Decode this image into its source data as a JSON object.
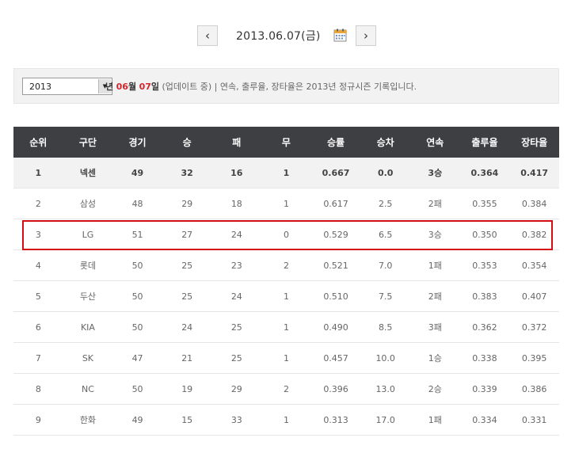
{
  "date_nav": {
    "prev_label": "‹",
    "next_label": "›",
    "date": "2013.06.07(금)"
  },
  "filter": {
    "year_selected": "2013",
    "year_unit": "년",
    "month": "06",
    "month_unit": "월",
    "day": "07",
    "day_unit": "일",
    "note": "(업데이트 중) | 연속, 출루율, 장타율은 2013년 정규시즌 기록입니다."
  },
  "table": {
    "headers": [
      "순위",
      "구단",
      "경기",
      "승",
      "패",
      "무",
      "승률",
      "승차",
      "연속",
      "출루율",
      "장타율"
    ],
    "rows": [
      [
        "1",
        "넥센",
        "49",
        "32",
        "16",
        "1",
        "0.667",
        "0.0",
        "3승",
        "0.364",
        "0.417"
      ],
      [
        "2",
        "삼성",
        "48",
        "29",
        "18",
        "1",
        "0.617",
        "2.5",
        "2패",
        "0.355",
        "0.384"
      ],
      [
        "3",
        "LG",
        "51",
        "27",
        "24",
        "0",
        "0.529",
        "6.5",
        "3승",
        "0.350",
        "0.382"
      ],
      [
        "4",
        "롯데",
        "50",
        "25",
        "23",
        "2",
        "0.521",
        "7.0",
        "1패",
        "0.353",
        "0.354"
      ],
      [
        "5",
        "두산",
        "50",
        "25",
        "24",
        "1",
        "0.510",
        "7.5",
        "2패",
        "0.383",
        "0.407"
      ],
      [
        "6",
        "KIA",
        "50",
        "24",
        "25",
        "1",
        "0.490",
        "8.5",
        "3패",
        "0.362",
        "0.372"
      ],
      [
        "7",
        "SK",
        "47",
        "21",
        "25",
        "1",
        "0.457",
        "10.0",
        "1승",
        "0.338",
        "0.395"
      ],
      [
        "8",
        "NC",
        "50",
        "19",
        "29",
        "2",
        "0.396",
        "13.0",
        "2승",
        "0.339",
        "0.386"
      ],
      [
        "9",
        "한화",
        "49",
        "15",
        "33",
        "1",
        "0.313",
        "17.0",
        "1패",
        "0.334",
        "0.331"
      ]
    ],
    "highlighted_row": 2
  },
  "colors": {
    "header_bg": "#3e3f43",
    "accent_red": "#d2262c",
    "highlight_border": "#d30d12"
  }
}
